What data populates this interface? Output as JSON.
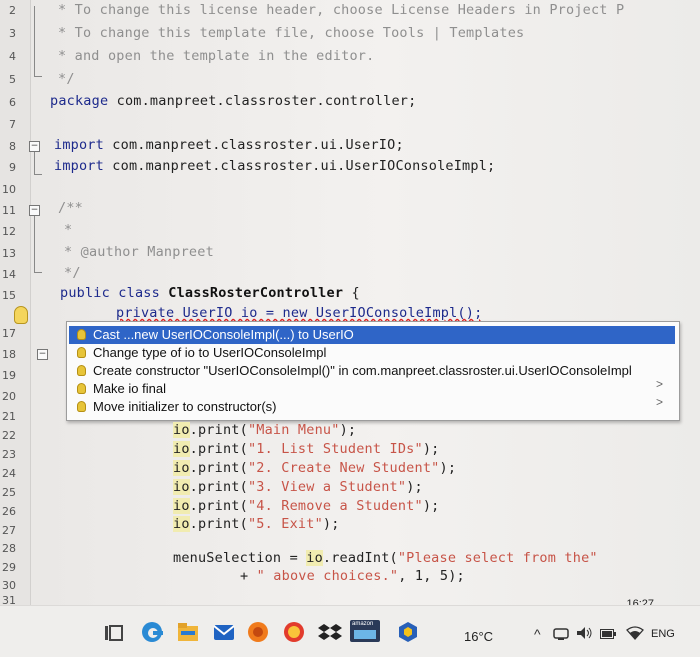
{
  "editor": {
    "line_numbers": [
      "2",
      "3",
      "4",
      "5",
      "6",
      "7",
      "8",
      "9",
      "10",
      "11",
      "12",
      "13",
      "14",
      "15",
      "17",
      "18",
      "19",
      "20",
      "21",
      "22",
      "23",
      "24",
      "25",
      "26",
      "27",
      "28",
      "29",
      "30",
      "31"
    ],
    "lines": {
      "l2": "* To change this license header, choose License Headers in Project P",
      "l3": "* To change this template file, choose Tools | Templates",
      "l4": "* and open the template in the editor.",
      "l5": "*/",
      "l6_kw": "package",
      "l6_rest": " com.manpreet.classroster.controller;",
      "l8_kw": "import",
      "l8_rest": " com.manpreet.classroster.ui.UserIO;",
      "l9_kw": "import",
      "l9_rest": " com.manpreet.classroster.ui.UserIOConsoleImpl;",
      "l11": "/**",
      "l12": "*",
      "l13": "* @author Manpreet",
      "l14": "*/",
      "l15_kw": "public class ",
      "l15_cls": "ClassRosterController",
      "l15_rest": " {",
      "l16": "private UserIO io = new UserIOConsoleImpl();",
      "l22_a": "io",
      "l22_b": ".print(",
      "l22_s": "\"Main Menu\"",
      "l22_c": ");",
      "l23_a": "io",
      "l23_b": ".print(",
      "l23_s": "\"1. List Student IDs\"",
      "l23_c": ");",
      "l24_a": "io",
      "l24_b": ".print(",
      "l24_s": "\"2. Create New Student\"",
      "l24_c": ");",
      "l25_a": "io",
      "l25_b": ".print(",
      "l25_s": "\"3. View a Student\"",
      "l25_c": ");",
      "l26_a": "io",
      "l26_b": ".print(",
      "l26_s": "\"4. Remove a Student\"",
      "l26_c": ");",
      "l27_a": "io",
      "l27_b": ".print(",
      "l27_s": "\"5. Exit\"",
      "l27_c": ");",
      "l29_a": "menuSelection = ",
      "l29_io": "io",
      "l29_b": ".readInt(",
      "l29_s": "\"Please select from the\"",
      "l30_a": "+ ",
      "l30_s": "\" above choices.\"",
      "l30_b": ", 1, 5);"
    }
  },
  "popup": {
    "items": [
      "Cast ...new UserIOConsoleImpl(...) to UserIO",
      "Change type of io to UserIOConsoleImpl",
      "Create constructor \"UserIOConsoleImpl()\" in com.manpreet.classroster.ui.UserIOConsoleImpl",
      "Make io final",
      "Move initializer to constructor(s)"
    ],
    "arrows": [
      ">",
      ">"
    ]
  },
  "taskbar": {
    "time": "16:27",
    "temperature": "16°C",
    "language": "ENG",
    "store_label": "amazon"
  }
}
